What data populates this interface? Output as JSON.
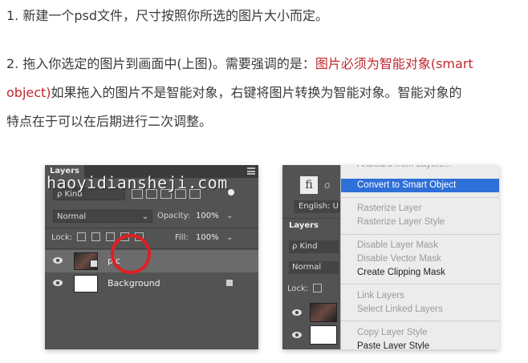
{
  "article": {
    "step1": "1. 新建一个psd文件，尺寸按照你所选的图片大小而定。",
    "step2_line1_pre": "2. 拖入你选定的图片到画面中(上图)。需要强调的是：",
    "step2_line1_highlight": "图片必须为智能对象(smart",
    "step2_line2_highlight": "object)",
    "step2_line2_post": "如果拖入的图片不是智能对象，右键将图片转换为智能对象。智能对象的",
    "step2_line3": "特点在于可以在后期进行二次调整。",
    "highlight_color": "#c0282f"
  },
  "left_panel": {
    "tab_label": "Layers",
    "watermark": "haoyidiansheji.com",
    "kind_label": "ρ Kind",
    "blend_mode": "Normal",
    "opacity_label": "Opacity:",
    "opacity_value": "100%",
    "lock_label": "Lock:",
    "fill_label": "Fill:",
    "fill_value": "100%",
    "layers": [
      {
        "name": "pic"
      },
      {
        "name": "Background"
      }
    ],
    "highlight_circle_color": "#e01f26"
  },
  "right_panel": {
    "fi_label": "fi",
    "o_label": "o",
    "lang_label": "English: U",
    "layers_tab": "Layers",
    "kind_label": "ρ Kind",
    "blend_mode": "Normal",
    "lock_label": "Lock:",
    "menu_items": [
      {
        "label": "Artboard from Layers...",
        "state": "disabled"
      },
      {
        "label": "Convert to Smart Object",
        "state": "active"
      },
      {
        "label": "Rasterize Layer",
        "state": "disabled"
      },
      {
        "label": "Rasterize Layer Style",
        "state": "disabled"
      },
      {
        "label": "Disable Layer Mask",
        "state": "disabled"
      },
      {
        "label": "Disable Vector Mask",
        "state": "disabled"
      },
      {
        "label": "Create Clipping Mask",
        "state": "enabled"
      },
      {
        "label": "Link Layers",
        "state": "disabled"
      },
      {
        "label": "Select Linked Layers",
        "state": "disabled"
      },
      {
        "label": "Copy Layer Style",
        "state": "disabled"
      },
      {
        "label": "Paste Layer Style",
        "state": "enabled"
      }
    ],
    "active_color": "#2f6fd8"
  }
}
